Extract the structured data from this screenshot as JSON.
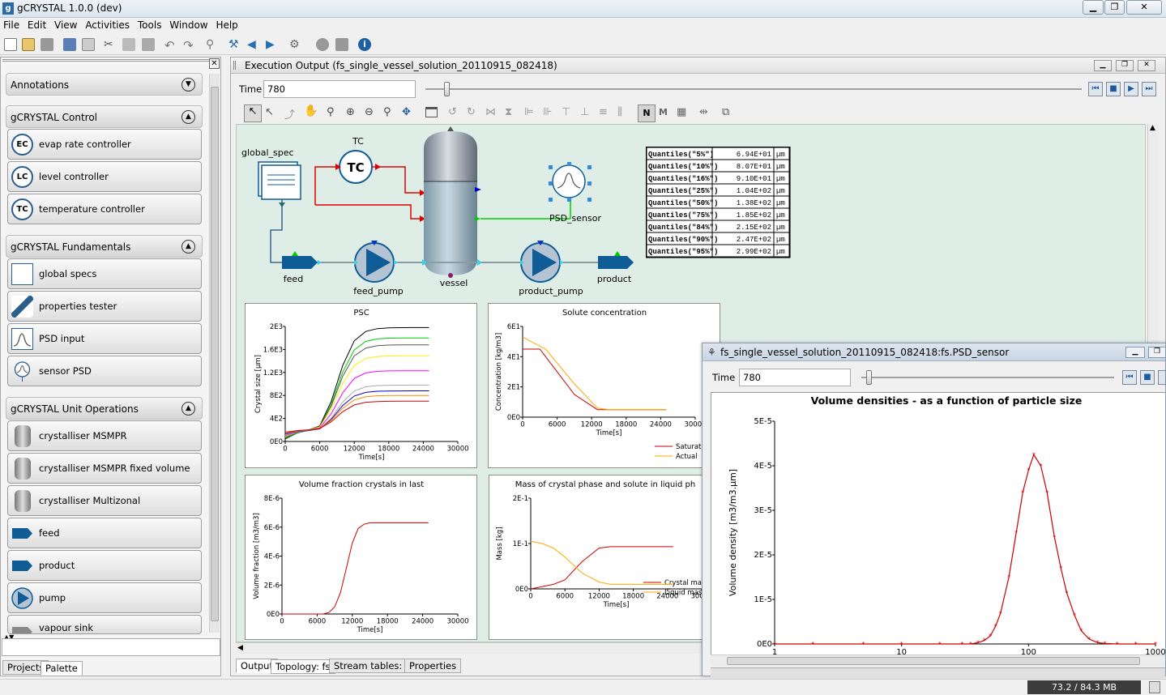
{
  "window": {
    "title": "gCRYSTAL 1.0.0 (dev)",
    "min": "▁",
    "max": "❐",
    "close": "✕"
  },
  "menu": [
    "File",
    "Edit",
    "View",
    "Activities",
    "Tools",
    "Window",
    "Help"
  ],
  "palette": {
    "sections": [
      {
        "label": "Annotations"
      },
      {
        "label": "gCRYSTAL Control",
        "items": [
          {
            "label": "evap rate controller",
            "icon": "EC"
          },
          {
            "label": "level controller",
            "icon": "LC"
          },
          {
            "label": "temperature controller",
            "icon": "TC"
          }
        ]
      },
      {
        "label": "gCRYSTAL Fundamentals",
        "items": [
          {
            "label": "global specs"
          },
          {
            "label": "properties tester"
          },
          {
            "label": "PSD input"
          },
          {
            "label": "sensor PSD"
          }
        ]
      },
      {
        "label": "gCRYSTAL Unit Operations",
        "items": [
          {
            "label": "crystalliser MSMPR"
          },
          {
            "label": "crystalliser MSMPR fixed volume"
          },
          {
            "label": "crystalliser Multizonal"
          },
          {
            "label": "feed"
          },
          {
            "label": "product"
          },
          {
            "label": "pump"
          },
          {
            "label": "vapour sink"
          }
        ]
      }
    ],
    "tabs": [
      "Projects",
      "Palette"
    ]
  },
  "exec": {
    "title": "Execution Output (fs_single_vessel_solution_20110915_082418)",
    "time_label": "Time",
    "time_value": "780",
    "tabs": [
      "Output",
      "Topology: fs",
      "Stream tables: fs",
      "Properties"
    ]
  },
  "flowsheet": {
    "global_spec": "global_spec",
    "tc_label": "TC",
    "tc_text": "TC",
    "feed": "feed",
    "feed_pump": "feed_pump",
    "vessel": "vessel",
    "product_pump": "product_pump",
    "product": "product",
    "psd_sensor": "PSD_sensor"
  },
  "quantiles": [
    {
      "name": "Quantiles(\"5%\")",
      "value": "6.94E+01",
      "unit": "µm"
    },
    {
      "name": "Quantiles(\"10%\")",
      "value": "8.07E+01",
      "unit": "µm"
    },
    {
      "name": "Quantiles(\"16%\")",
      "value": "9.10E+01",
      "unit": "µm"
    },
    {
      "name": "Quantiles(\"25%\")",
      "value": "1.04E+02",
      "unit": "µm"
    },
    {
      "name": "Quantiles(\"50%\")",
      "value": "1.38E+02",
      "unit": "µm"
    },
    {
      "name": "Quantiles(\"75%\")",
      "value": "1.85E+02",
      "unit": "µm"
    },
    {
      "name": "Quantiles(\"84%\")",
      "value": "2.15E+02",
      "unit": "µm"
    },
    {
      "name": "Quantiles(\"90%\")",
      "value": "2.47E+02",
      "unit": "µm"
    },
    {
      "name": "Quantiles(\"95%\")",
      "value": "2.99E+02",
      "unit": "µm"
    }
  ],
  "chart_data": [
    {
      "type": "line",
      "title": "PSC",
      "xlabel": "Time[s]",
      "ylabel": "Crystal size [µm]",
      "xlim": [
        0,
        30000
      ],
      "ylim": [
        0,
        2000
      ],
      "xticks": [
        "0",
        "6000",
        "12000",
        "18000",
        "24000",
        "30000"
      ],
      "yticks": [
        "0E0",
        "4E2",
        "8E2",
        "1.2E3",
        "1.6E3",
        "2E3"
      ],
      "series": [
        {
          "color": "#000000",
          "plateau": 1980
        },
        {
          "color": "#00cc00",
          "plateau": 1800
        },
        {
          "color": "#555555",
          "plateau": 1680
        },
        {
          "color": "#ffee00",
          "plateau": 1490
        },
        {
          "color": "#ff00ff",
          "plateau": 1230
        },
        {
          "color": "#aaaaaa",
          "plateau": 980
        },
        {
          "color": "#0000cc",
          "plateau": 880
        },
        {
          "color": "#ff8800",
          "plateau": 800
        },
        {
          "color": "#cc0000",
          "plateau": 700
        }
      ]
    },
    {
      "type": "line",
      "title": "Solute concentration",
      "xlabel": "Time[s]",
      "ylabel": "Concentration [kg/m3]",
      "xlim": [
        0,
        30000
      ],
      "ylim": [
        0,
        60
      ],
      "xticks": [
        "0",
        "6000",
        "12000",
        "18000",
        "24000",
        "30000"
      ],
      "yticks": [
        "0E0",
        "2E1",
        "4E1",
        "6E1"
      ],
      "series": [
        {
          "name": "Saturation",
          "color": "#cc0000",
          "x": [
            0,
            3000,
            4000,
            9000,
            13000,
            15000,
            25000
          ],
          "y": [
            45,
            45,
            40,
            15,
            5,
            5,
            5
          ]
        },
        {
          "name": "Actual",
          "color": "#ffaa00",
          "x": [
            0,
            1000,
            4000,
            9000,
            13000,
            15000,
            25000
          ],
          "y": [
            53,
            51,
            45,
            22,
            6,
            5,
            5
          ]
        }
      ]
    },
    {
      "type": "line",
      "title": "Volume fraction crystals in last",
      "xlabel": "Time[s]",
      "ylabel": "Volume fraction [m3/m3]",
      "xlim": [
        0,
        30000
      ],
      "ylim": [
        0,
        8e-06
      ],
      "xticks": [
        "0",
        "6000",
        "12000",
        "18000",
        "24000",
        "30000"
      ],
      "yticks": [
        "0E0",
        "2E-6",
        "4E-6",
        "6E-6",
        "8E-6"
      ],
      "series": [
        {
          "color": "#cc0000",
          "x": [
            0,
            7000,
            8000,
            9000,
            10000,
            11000,
            12000,
            13000,
            14000,
            15000,
            18000,
            25000
          ],
          "y": [
            0,
            0,
            1e-07,
            5e-07,
            1.5e-06,
            3.2e-06,
            4.9e-06,
            5.9e-06,
            6.2e-06,
            6.3e-06,
            6.3e-06,
            6.3e-06
          ]
        }
      ]
    },
    {
      "type": "line",
      "title": "Mass of crystal phase and solute in liquid ph",
      "xlabel": "Time[s]",
      "ylabel": "Mass [kg]",
      "xlim": [
        0,
        30000
      ],
      "ylim": [
        0,
        0.2
      ],
      "xticks": [
        "0",
        "6000",
        "12000",
        "18000",
        "24000",
        "30000"
      ],
      "yticks": [
        "0E0",
        "1E-1",
        "2E-1"
      ],
      "series": [
        {
          "name": "Crystal ma",
          "color": "#cc0000",
          "x": [
            0,
            4000,
            6000,
            9000,
            12000,
            14000,
            25000
          ],
          "y": [
            0,
            0.01,
            0.02,
            0.06,
            0.09,
            0.093,
            0.093
          ]
        },
        {
          "name": "Liquid mass",
          "color": "#ffaa00",
          "x": [
            0,
            2000,
            4000,
            6000,
            9000,
            12000,
            14000,
            25000
          ],
          "y": [
            0.105,
            0.1,
            0.09,
            0.07,
            0.035,
            0.015,
            0.01,
            0.01
          ]
        }
      ]
    },
    {
      "type": "line",
      "title": "Volume densities - as a function of particle size",
      "xlabel": "",
      "ylabel": "Volume density [m3/m3.µm]",
      "xscale": "log",
      "xlim": [
        1,
        1000
      ],
      "ylim": [
        0,
        5e-05
      ],
      "xticks": [
        "1",
        "10",
        "100",
        "1000"
      ],
      "yticks": [
        "0E0",
        "1E-5",
        "2E-5",
        "3E-5",
        "4E-5",
        "5E-5"
      ],
      "series": [
        {
          "color": "#cc0000",
          "x": [
            1,
            2,
            5,
            10,
            20,
            30,
            35,
            40,
            45,
            50,
            55,
            60,
            70,
            80,
            90,
            100,
            110,
            125,
            140,
            160,
            180,
            200,
            230,
            260,
            300,
            350,
            400,
            500,
            700,
            1000
          ],
          "y": [
            0,
            0,
            0,
            0,
            0,
            0,
            0,
            3e-07,
            8e-07,
            1.8e-06,
            4e-06,
            6.8e-06,
            1.5e-05,
            2.5e-05,
            3.4e-05,
            3.9e-05,
            4.25e-05,
            4e-05,
            3.4e-05,
            2.4e-05,
            1.7e-05,
            1.15e-05,
            6.5e-06,
            3e-06,
            1.1e-06,
            3e-07,
            1e-07,
            0,
            0,
            0
          ]
        }
      ]
    }
  ],
  "sensor": {
    "title": "fs_single_vessel_solution_20110915_082418:fs.PSD_sensor",
    "time_label": "Time",
    "time_value": "780"
  },
  "status": {
    "memory": "73.2 / 84.3 MB"
  }
}
